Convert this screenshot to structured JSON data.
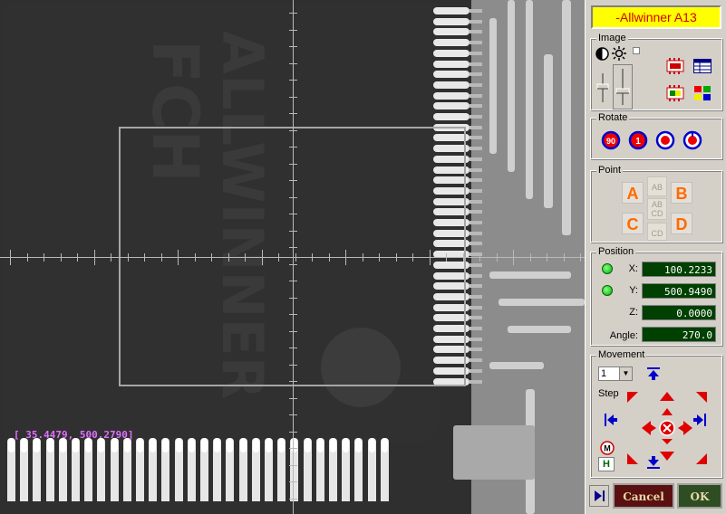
{
  "device": {
    "title": "-Allwinner A13"
  },
  "camera": {
    "coord_readout": "[  35.4479,  500.2790]",
    "chip_marking": [
      "ALLWINNER",
      "FCH"
    ]
  },
  "image": {
    "label": "Image"
  },
  "rotate": {
    "label": "Rotate"
  },
  "point": {
    "label": "Point",
    "a": "A",
    "b": "B",
    "c": "C",
    "d": "D",
    "ab": "AB",
    "cd": "CD",
    "abcd_top": "AB",
    "abcd_bottom": "CD"
  },
  "position": {
    "label": "Position",
    "x_label": "X:",
    "x_value": "100.2233",
    "y_label": "Y:",
    "y_value": "500.9490",
    "z_label": "Z:",
    "z_value": "0.0000",
    "angle_label": "Angle:",
    "angle_value": "270.0"
  },
  "movement": {
    "label": "Movement",
    "step_label": "Step",
    "step_value": "1",
    "m_label": "M",
    "h_label": "H"
  },
  "footer": {
    "cancel_label": "Cancel",
    "ok_label": "OK"
  },
  "colors": {
    "title_bg": "#ffff00",
    "title_text": "#d40000",
    "value_bg": "#004000",
    "arrow_red": "#e00000",
    "home_blue": "#0000cc"
  }
}
